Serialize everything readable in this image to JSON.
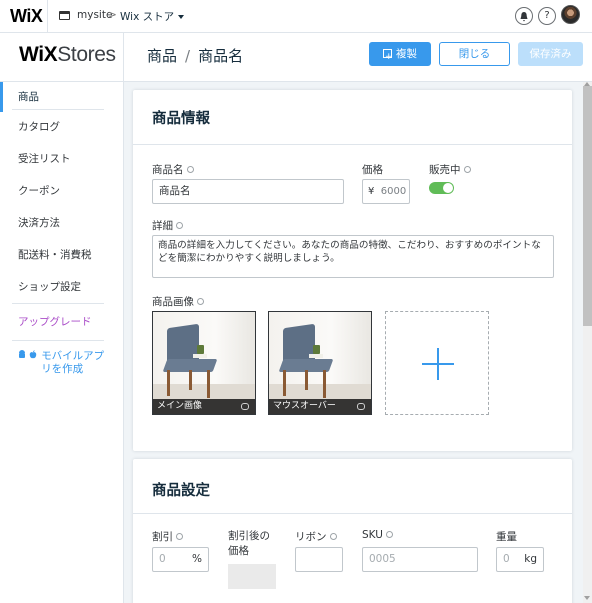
{
  "topbar": {
    "logo": "WiX",
    "site_name": "mysite",
    "crumb_separator": ">",
    "store_menu": "Wix ストア",
    "help_label": "?"
  },
  "header": {
    "logo_prefix": "WiX",
    "logo_suffix": "Stores",
    "title_section": "商品",
    "title_separator": "/",
    "title_item": "商品名",
    "duplicate_label": "複製",
    "close_label": "閉じる",
    "save_label": "保存済み"
  },
  "sidebar": {
    "items": [
      {
        "label": "商品"
      },
      {
        "label": "カタログ"
      },
      {
        "label": "受注リスト"
      },
      {
        "label": "クーポン"
      },
      {
        "label": "決済方法"
      },
      {
        "label": "配送料・消費税"
      },
      {
        "label": "ショップ設定"
      }
    ],
    "upgrade": "アップグレード",
    "mobile_app": "モバイルアプリを作成"
  },
  "product_info": {
    "title": "商品情報",
    "name_label": "商品名",
    "name_value": "商品名",
    "price_label": "価格",
    "price_currency": "¥",
    "price_value": "6000",
    "on_sale_label": "販売中",
    "on_sale": true,
    "details_label": "詳細",
    "details_placeholder": "商品の詳細を入力してください。あなたの商品の特徴、こだわり、おすすめのポイントなどを簡潔にわかりやすく説明しましょう。",
    "images_label": "商品画像",
    "images": [
      {
        "caption": "メイン画像"
      },
      {
        "caption": "マウスオーバー"
      }
    ]
  },
  "product_settings": {
    "title": "商品設定",
    "discount_label": "割引",
    "discount_value": "0",
    "discount_unit": "%",
    "discounted_price_label_1": "割引後の",
    "discounted_price_label_2": "価格",
    "ribbon_label": "リボン",
    "sku_label": "SKU",
    "sku_value": "0005",
    "weight_label": "重量",
    "weight_value": "0",
    "weight_unit": "kg"
  },
  "colors": {
    "accent": "#3899ec",
    "toggle_on": "#60bc57",
    "upgrade": "#aa4dc8"
  }
}
